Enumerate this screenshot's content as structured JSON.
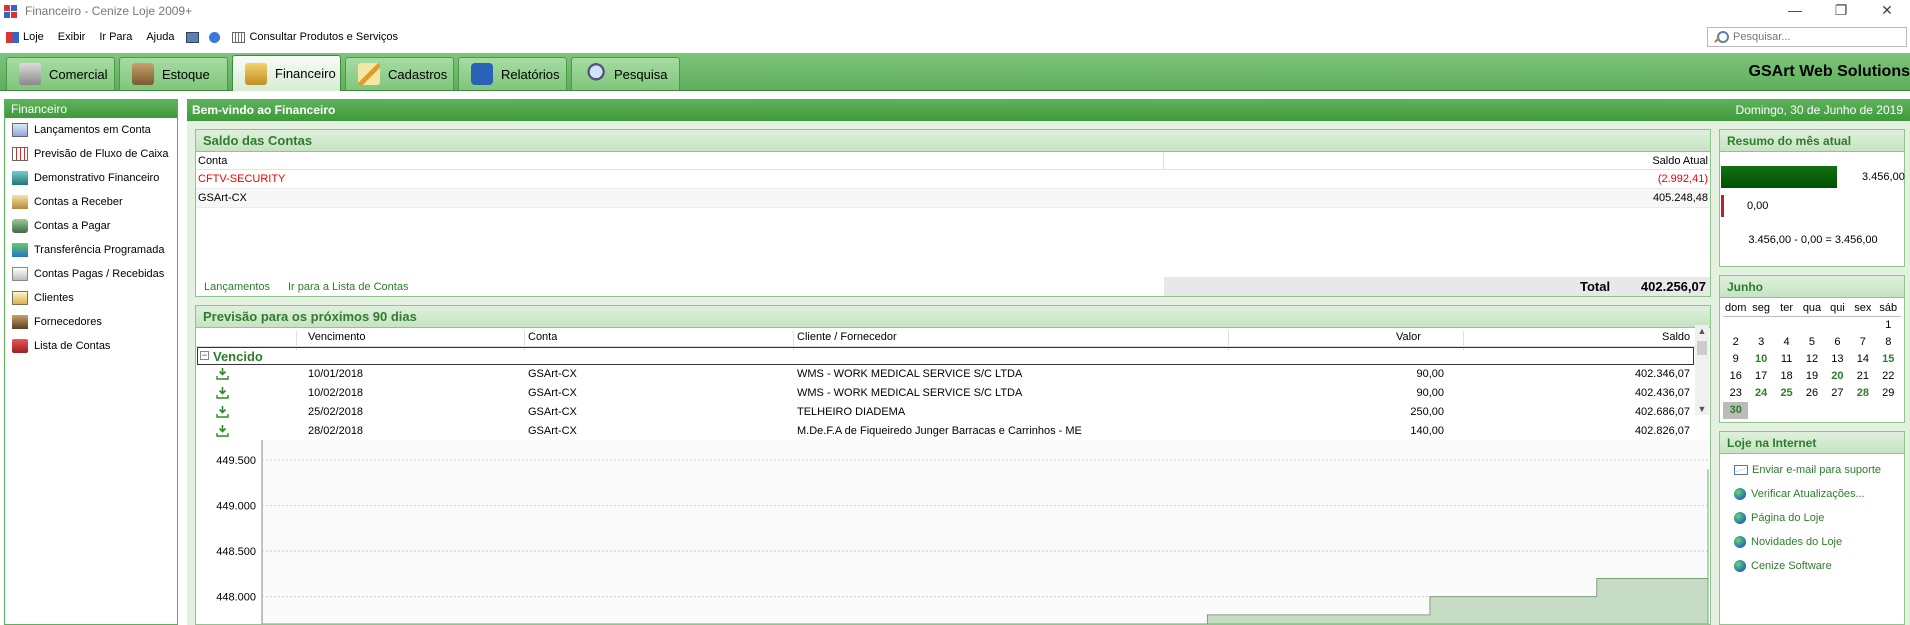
{
  "window": {
    "title": "Financeiro - Cenize Loje 2009+",
    "minimize": "—",
    "restore": "❐",
    "close": "✕"
  },
  "menu": {
    "items": [
      "Loje",
      "Exibir",
      "Ir Para",
      "Ajuda"
    ],
    "consultar": "Consultar Produtos e Serviços",
    "search_placeholder": "Pesquisar..."
  },
  "tabs": [
    "Comercial",
    "Estoque",
    "Financeiro",
    "Cadastros",
    "Relatórios",
    "Pesquisa"
  ],
  "active_tab": "Financeiro",
  "brand": "GSArt Web Solutions",
  "sidebar": {
    "title": "Financeiro",
    "items": [
      "Lançamentos em Conta",
      "Previsão de Fluxo de Caixa",
      "Demonstrativo Financeiro",
      "Contas a Receber",
      "Contas a Pagar",
      "Transferência Programada",
      "Contas Pagas / Recebidas",
      "Clientes",
      "Fornecedores",
      "Lista de Contas"
    ]
  },
  "welcome": {
    "title": "Bem-vindo ao Financeiro",
    "date": "Domingo, 30 de Junho de 2019"
  },
  "saldo": {
    "title": "Saldo das Contas",
    "col_conta": "Conta",
    "col_saldo": "Saldo Atual",
    "rows": [
      {
        "conta": "CFTV-SECURITY",
        "saldo": "(2.992,41)",
        "negative": true
      },
      {
        "conta": "GSArt-CX",
        "saldo": "405.248,48",
        "negative": false
      }
    ],
    "link_lancamentos": "Lançamentos",
    "link_lista": "Ir para a Lista de Contas",
    "total_label": "Total",
    "total_value": "402.256,07"
  },
  "previsao": {
    "title": "Previsão para os próximos 90 dias",
    "columns": [
      "Vencimento",
      "Conta",
      "Cliente / Fornecedor",
      "Valor",
      "Saldo"
    ],
    "group": "Vencido",
    "rows": [
      {
        "venc": "10/01/2018",
        "conta": "GSArt-CX",
        "cliente": "WMS - WORK MEDICAL SERVICE S/C LTDA",
        "valor": "90,00",
        "saldo": "402.346,07"
      },
      {
        "venc": "10/02/2018",
        "conta": "GSArt-CX",
        "cliente": "WMS - WORK MEDICAL SERVICE S/C LTDA",
        "valor": "90,00",
        "saldo": "402.436,07"
      },
      {
        "venc": "25/02/2018",
        "conta": "GSArt-CX",
        "cliente": "TELHEIRO DIADEMA",
        "valor": "250,00",
        "saldo": "402.686,07"
      },
      {
        "venc": "28/02/2018",
        "conta": "GSArt-CX",
        "cliente": "M.De.F.A de Fiqueiredo Junger Barracas e Carrinhos - ME",
        "valor": "140,00",
        "saldo": "402.826,07"
      }
    ]
  },
  "chart_data": {
    "type": "area",
    "title": "",
    "xlabel": "",
    "ylabel": "",
    "y_ticks": [
      "449.500",
      "449.000",
      "448.500",
      "448.000"
    ],
    "ylim": [
      447.7,
      449.72
    ],
    "x": [
      0,
      1,
      2,
      3,
      4,
      5,
      6,
      7,
      8,
      9,
      10,
      11,
      12,
      13,
      14,
      15,
      16,
      17,
      18,
      19,
      20,
      21,
      22,
      23,
      24,
      25,
      26
    ],
    "values": [
      447.7,
      447.7,
      447.7,
      447.7,
      447.7,
      447.7,
      447.7,
      447.7,
      447.7,
      447.7,
      447.7,
      447.7,
      447.7,
      447.7,
      447.7,
      447.7,
      447.7,
      447.8,
      447.8,
      447.8,
      447.8,
      448.0,
      448.0,
      448.0,
      448.2,
      448.2,
      449.4
    ],
    "grid": true,
    "color": "#c7dcc4"
  },
  "resumo": {
    "title": "Resumo do mês atual",
    "income": "3.456,00",
    "expense": "0,00",
    "income_ratio": 1.0,
    "formula": "3.456,00 - 0,00 = 3.456,00"
  },
  "calendar": {
    "title": "Junho",
    "dow": [
      "dom",
      "seg",
      "ter",
      "qua",
      "qui",
      "sex",
      "sáb"
    ],
    "lead_blanks": 6,
    "days": 30,
    "highlight": [
      10,
      15,
      20,
      24,
      25,
      28
    ],
    "today": 30
  },
  "internet": {
    "title": "Loje na Internet",
    "items": [
      "Enviar e-mail para suporte",
      "Verificar Atualizações...",
      "Página do Loje",
      "Novidades do Loje",
      "Cenize Software"
    ]
  }
}
